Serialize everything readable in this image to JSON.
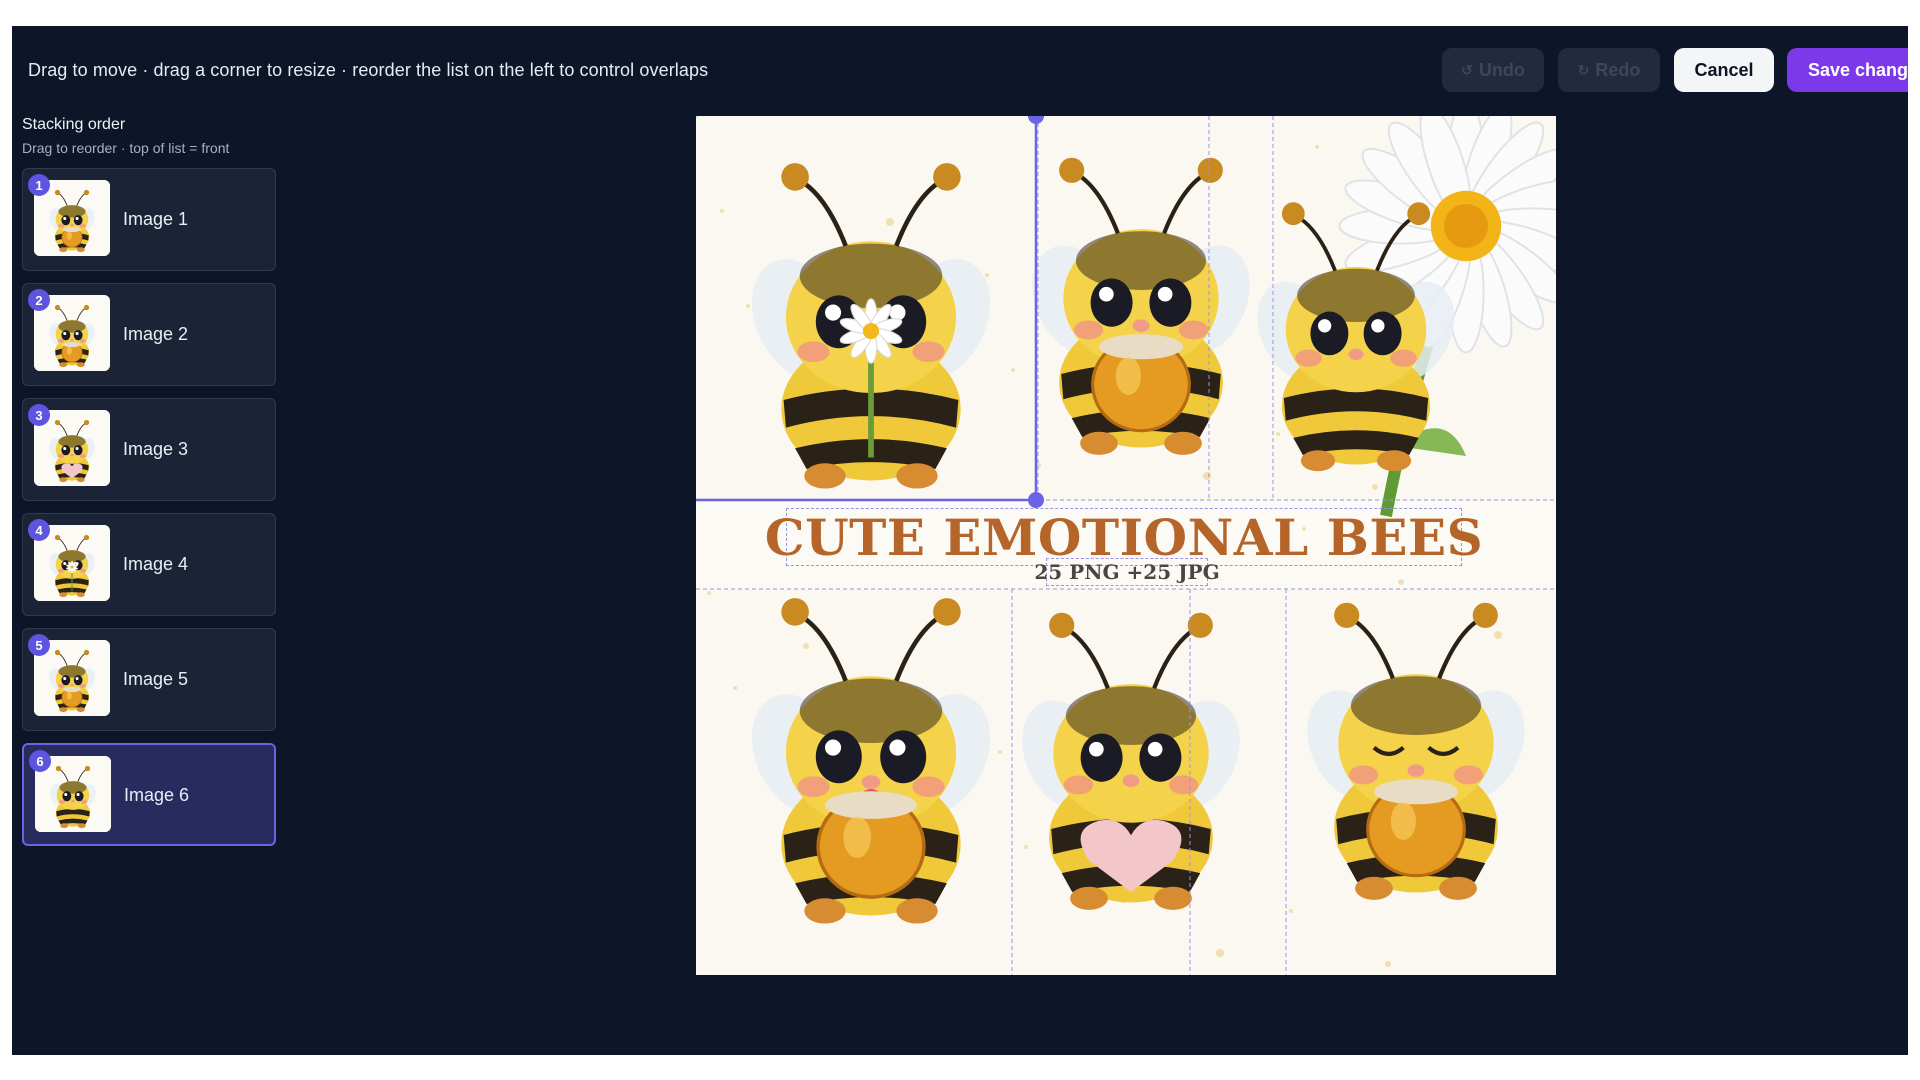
{
  "toolbar": {
    "hint": "Drag to move · drag a corner to resize · reorder the list on the left to control overlaps",
    "undo_label": "Undo",
    "redo_label": "Redo",
    "cancel_label": "Cancel",
    "save_label": "Save chang"
  },
  "sidebar": {
    "title": "Stacking order",
    "subtitle": "Drag to reorder · top of list = front",
    "layers": [
      {
        "index": "1",
        "label": "Image 1",
        "selected": false
      },
      {
        "index": "2",
        "label": "Image 2",
        "selected": false
      },
      {
        "index": "3",
        "label": "Image 3",
        "selected": false
      },
      {
        "index": "4",
        "label": "Image 4",
        "selected": false
      },
      {
        "index": "5",
        "label": "Image 5",
        "selected": false
      },
      {
        "index": "6",
        "label": "Image 6",
        "selected": true
      }
    ]
  },
  "canvas": {
    "title": "CUTE EMOTIONAL BEES",
    "subtitle": "25 PNG +25 JPG"
  },
  "colors": {
    "app_bg": "#0d1628",
    "accent": "#7b39ea",
    "selection": "#6a63e6",
    "title_text": "#b5652a"
  },
  "icons": {
    "undo": "undo-icon",
    "redo": "redo-icon"
  }
}
